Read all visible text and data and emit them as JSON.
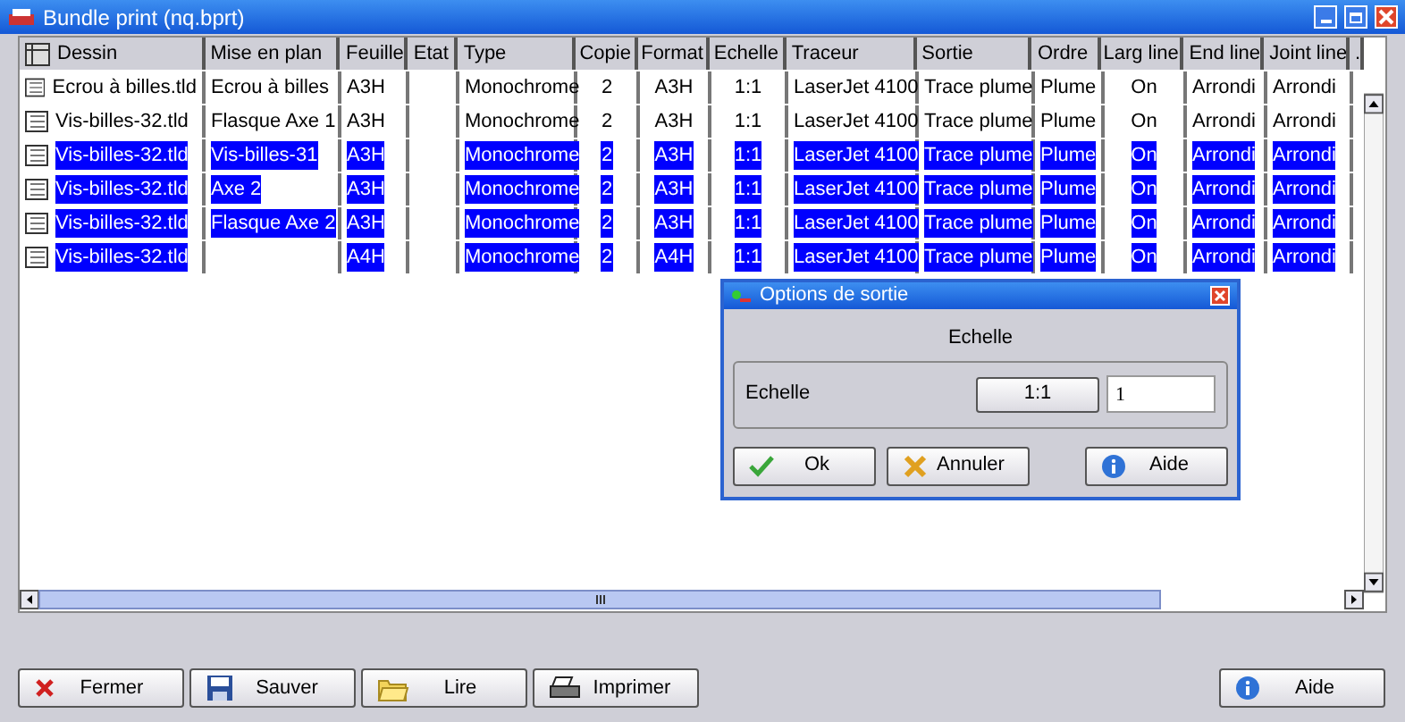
{
  "window": {
    "title": "Bundle print (nq.bprt)"
  },
  "table": {
    "columns": [
      "Dessin",
      "Mise en plan",
      "Feuille",
      "Etat",
      "Type",
      "Copie",
      "Format",
      "Echelle",
      "Traceur",
      "Sortie",
      "Ordre",
      "Larg line",
      "End line",
      "Joint line",
      "."
    ],
    "rows": [
      {
        "selected": false,
        "cells": [
          "Ecrou à billes.tld",
          "Ecrou à billes",
          "A3H",
          null,
          "Monochrome",
          "2",
          "A3H",
          "1:1",
          "LaserJet 4100",
          "Trace plume",
          "Plume",
          "On",
          "Arrondi",
          "Arrondi"
        ]
      },
      {
        "selected": false,
        "cells": [
          "Vis-billes-32.tld",
          "Flasque Axe 1",
          "A3H",
          null,
          "Monochrome",
          "2",
          "A3H",
          "1:1",
          "LaserJet 4100",
          "Trace plume",
          "Plume",
          "On",
          "Arrondi",
          "Arrondi"
        ]
      },
      {
        "selected": true,
        "cells": [
          "Vis-billes-32.tld",
          "Vis-billes-31",
          "A3H",
          null,
          "Monochrome",
          "2",
          "A3H",
          "1:1",
          "LaserJet 4100",
          "Trace plume",
          "Plume",
          "On",
          "Arrondi",
          "Arrondi"
        ]
      },
      {
        "selected": true,
        "cells": [
          "Vis-billes-32.tld",
          "Axe 2",
          "A3H",
          null,
          "Monochrome",
          "2",
          "A3H",
          "1:1",
          "LaserJet 4100",
          "Trace plume",
          "Plume",
          "On",
          "Arrondi",
          "Arrondi"
        ]
      },
      {
        "selected": true,
        "cells": [
          "Vis-billes-32.tld",
          "Flasque Axe 2",
          "A3H",
          null,
          "Monochrome",
          "2",
          "A3H",
          "1:1",
          "LaserJet 4100",
          "Trace plume",
          "Plume",
          "On",
          "Arrondi",
          "Arrondi"
        ]
      },
      {
        "selected": true,
        "cells": [
          "Vis-billes-32.tld",
          null,
          "A4H",
          null,
          "Monochrome",
          "2",
          "A4H",
          "1:1",
          "LaserJet 4100",
          "Trace plume",
          "Plume",
          "On",
          "Arrondi",
          "Arrondi"
        ]
      }
    ]
  },
  "buttons": [
    {
      "kind": "close",
      "label": "Fermer"
    },
    {
      "kind": "save",
      "label": "Sauver"
    },
    {
      "kind": "open",
      "label": "Lire"
    },
    {
      "kind": "print",
      "label": "Imprimer"
    },
    {
      "kind": "help",
      "label": "Aide"
    }
  ],
  "dialog": {
    "title": "Options de sortie",
    "group_title": "Echelle",
    "label": "Echelle",
    "scale_button": "1:1",
    "value": "1",
    "buttons": [
      {
        "kind": "ok",
        "label": "Ok"
      },
      {
        "kind": "cancel",
        "label": "Annuler"
      },
      {
        "kind": "help",
        "label": "Aide"
      }
    ]
  }
}
